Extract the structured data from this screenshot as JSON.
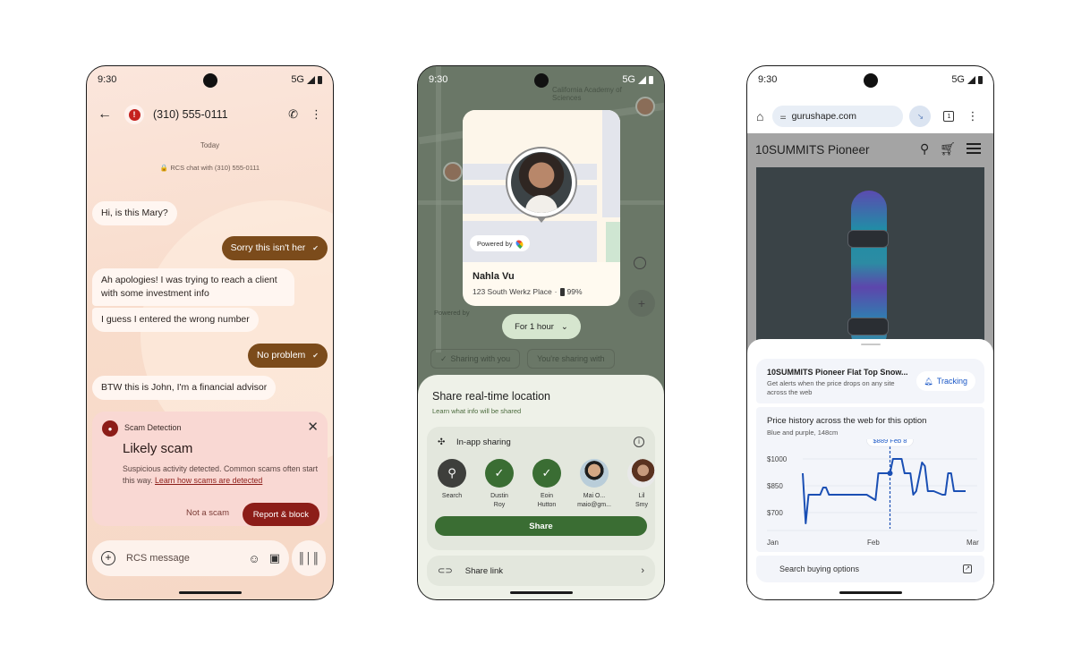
{
  "status_bar": {
    "time": "9:30",
    "network": "5G"
  },
  "messages_app": {
    "contact_number": "(310) 555-0111",
    "date_label": "Today",
    "rcs_notice": "RCS chat with (310) 555-0111",
    "messages": [
      {
        "direction": "incoming",
        "text": "Hi, is this Mary?"
      },
      {
        "direction": "outgoing",
        "text": "Sorry this isn't her",
        "status": "read"
      },
      {
        "direction": "incoming",
        "text": "Ah apologies! I was trying to reach a client with some investment info"
      },
      {
        "direction": "incoming",
        "text": "I guess I entered the wrong number"
      },
      {
        "direction": "outgoing",
        "text": "No problem",
        "status": "read"
      },
      {
        "direction": "incoming",
        "text": "BTW this is John, I'm a financial advisor"
      }
    ],
    "scam_card": {
      "label": "Scam Detection",
      "title": "Likely scam",
      "body": "Suspicious activity detected. Common scams often start this way.",
      "link": "Learn how scams are detected",
      "secondary_action": "Not a scam",
      "primary_action": "Report & block",
      "accent_color": "#8c1d18"
    },
    "compose": {
      "placeholder": "RCS message"
    }
  },
  "location_app": {
    "map_labels": [
      "California Academy of Sciences"
    ],
    "card": {
      "powered_by": "Powered by",
      "name": "Nahla Vu",
      "address": "123 South Werkz Place",
      "battery": "99%"
    },
    "map_powered_by": "Powered by",
    "duration": "For 1 hour",
    "tabs": [
      "Sharing with you",
      "You're sharing with"
    ],
    "sheet": {
      "title": "Share real-time location",
      "subtitle": "Learn what info will be shared",
      "in_app_label": "In-app sharing",
      "contacts": [
        {
          "name_line1": "Search",
          "name_line2": "",
          "type": "search"
        },
        {
          "name_line1": "Dustin",
          "name_line2": "Roy",
          "type": "selected"
        },
        {
          "name_line1": "Eoin",
          "name_line2": "Hutton",
          "type": "selected"
        },
        {
          "name_line1": "Mai O...",
          "name_line2": "maio@gm...",
          "type": "photo"
        },
        {
          "name_line1": "Lil",
          "name_line2": "Smy",
          "type": "photo"
        }
      ],
      "share_button": "Share",
      "share_link": "Share link",
      "accent_color": "#3a6d33"
    }
  },
  "browser_app": {
    "url": "gurushape.com",
    "tab_count": "1",
    "site_title": "10SUMMITS Pioneer",
    "tracking_card": {
      "title": "10SUMMITS Pioneer Flat Top Snow...",
      "subtitle": "Get alerts when the price drops on any site across the web",
      "button": "Tracking"
    },
    "price_history": {
      "title": "Price history across the web for this option",
      "subtitle": "Blue and purple, 148cm"
    },
    "buying_options": "Search buying options"
  },
  "chart_data": {
    "type": "line",
    "title": "Price history across the web for this option",
    "subtitle": "Blue and purple, 148cm",
    "xlabel": "",
    "ylabel": "",
    "x_ticks": [
      "Jan",
      "Feb",
      "Mar"
    ],
    "y_ticks": [
      "$1000",
      "$850",
      "$700"
    ],
    "y_tick_values": [
      1000,
      850,
      700
    ],
    "ylim": [
      620,
      1060
    ],
    "xlim": [
      0,
      60
    ],
    "grid": true,
    "line_color": "#1a4fb4",
    "series": [
      {
        "name": "Price",
        "x": [
          0,
          1,
          2,
          3,
          6,
          7,
          8,
          9,
          14,
          22,
          24,
          25,
          26,
          29,
          29.5,
          30,
          31,
          33,
          34,
          35,
          37,
          38,
          39,
          41,
          42,
          43,
          44,
          45,
          48,
          49,
          50,
          51,
          52,
          53,
          54,
          56
        ],
        "y": [
          920,
          640,
          800,
          800,
          800,
          840,
          840,
          800,
          800,
          800,
          780,
          770,
          920,
          920,
          920,
          920,
          1000,
          1000,
          1000,
          920,
          920,
          800,
          820,
          980,
          960,
          820,
          820,
          820,
          800,
          800,
          920,
          920,
          820,
          820,
          820,
          820
        ]
      }
    ],
    "annotation": {
      "label": "$889 Feb 8",
      "x": 30,
      "y": 920
    }
  }
}
